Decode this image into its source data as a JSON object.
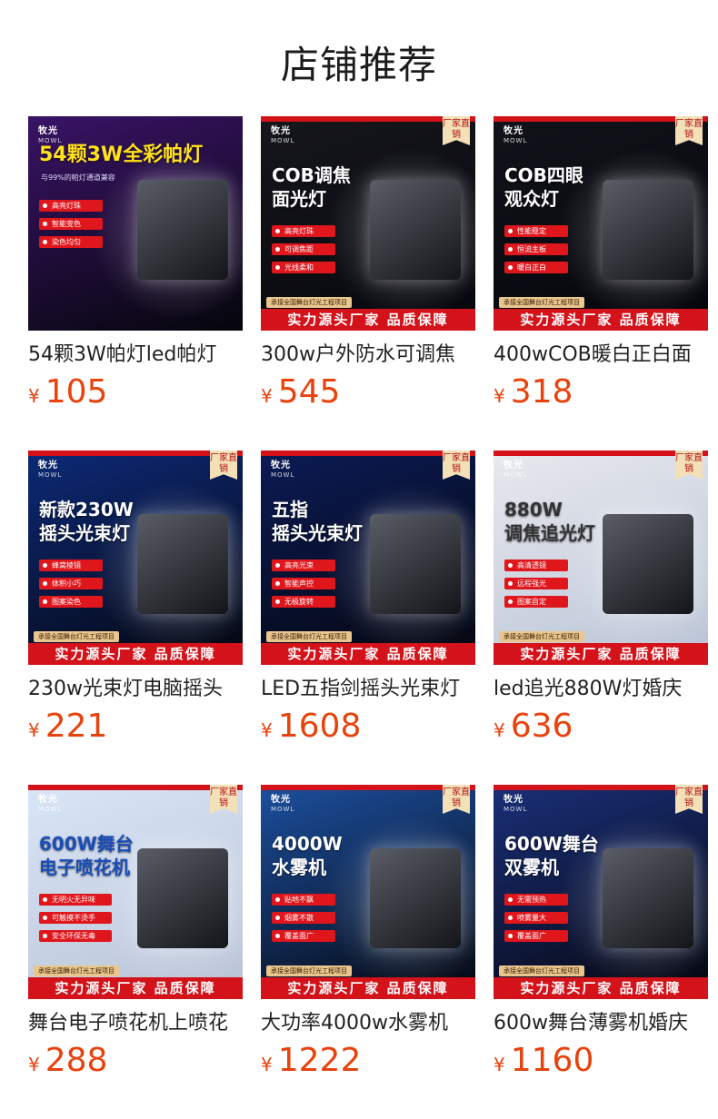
{
  "page_title": "店铺推荐",
  "common": {
    "factory_badge": "厂家直销",
    "bottom_banner": "实力源头厂家 品质保障",
    "sub_banner": "承接全国舞台灯光工程项目",
    "brand_logo": "牧光",
    "brand_logo_en": "MOWL",
    "currency": "¥"
  },
  "products": [
    {
      "name": "54颗3W帕灯led帕灯",
      "price": "105",
      "headline": "54颗3W全彩帕灯",
      "subtitle": "与99%的帕灯通道兼容",
      "features": [
        "高亮灯珠",
        "智能变色",
        "染色均匀"
      ],
      "bg": "#3a1366",
      "accent": "#ffe21a"
    },
    {
      "name": "300w户外防水可调焦",
      "price": "545",
      "headline": "COB调焦\n面光灯",
      "features": [
        "高亮灯珠",
        "可调焦距",
        "光线柔和"
      ],
      "bg": "#16171c",
      "accent": "#ffffff"
    },
    {
      "name": "400wCOB暖白正白面",
      "price": "318",
      "headline": "COB四眼\n观众灯",
      "features": [
        "性能稳定",
        "恒流主板",
        "暖白正白"
      ],
      "bg": "#12131a",
      "accent": "#ffffff"
    },
    {
      "name": "230w光束灯电脑摇头",
      "price": "221",
      "headline": "新款230W\n摇头光束灯",
      "features": [
        "蜂窝棱镜",
        "体积小巧",
        "图案染色"
      ],
      "bg": "#0d2a78",
      "accent": "#ffffff"
    },
    {
      "name": "LED五指剑摇头光束灯",
      "price": "1608",
      "headline": "五指\n摇头光束灯",
      "features": [
        "高亮光束",
        "智能声控",
        "无极旋转"
      ],
      "bg": "#0b1b55",
      "accent": "#ffffff"
    },
    {
      "name": "led追光880W灯婚庆",
      "price": "636",
      "headline": "880W\n调焦追光灯",
      "features": [
        "高清透镜",
        "远程强光",
        "图案自定"
      ],
      "bg": "#e8e9ee",
      "accent": "#333333"
    },
    {
      "name": "舞台电子喷花机上喷花",
      "price": "288",
      "headline": "600W舞台\n电子喷花机",
      "features": [
        "无明火无异味",
        "可触摸不烫手",
        "安全环保无毒"
      ],
      "bg": "#d9e6f7",
      "accent": "#1b4db8"
    },
    {
      "name": "大功率4000w水雾机",
      "price": "1222",
      "headline": "4000W\n水雾机",
      "features": [
        "贴地不飘",
        "烟雾不散",
        "覆盖面广"
      ],
      "bg": "#1c4f9e",
      "accent": "#ffffff"
    },
    {
      "name": "600w舞台薄雾机婚庆",
      "price": "1160",
      "headline": "600W舞台\n双雾机",
      "features": [
        "无需预热",
        "喷雾量大",
        "覆盖面广"
      ],
      "bg": "#1a2f78",
      "accent": "#ffffff"
    }
  ]
}
